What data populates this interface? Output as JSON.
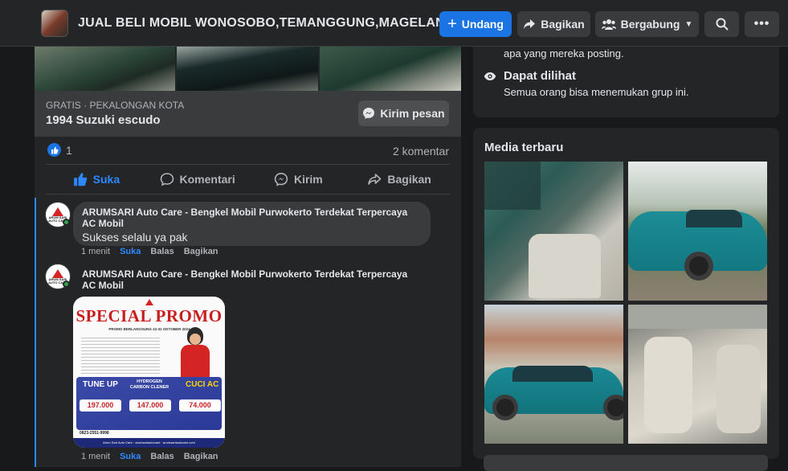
{
  "header": {
    "group_name": "JUAL BELI MOBIL WONOSOBO,TEMANGGUNG,MAGELANG",
    "invite_label": "Undang",
    "share_label": "Bagikan",
    "joined_label": "Bergabung",
    "search_icon": "search-icon",
    "more_icon": "more-icon"
  },
  "listing": {
    "meta": "GRATIS · PEKALONGAN KOTA",
    "title": "1994 Suzuki escudo",
    "message_label": "Kirim pesan"
  },
  "post_stats": {
    "like_count": "1",
    "comment_count": "2 komentar"
  },
  "post_actions": {
    "like": "Suka",
    "comment": "Komentari",
    "send": "Kirim",
    "share": "Bagikan"
  },
  "comments": [
    {
      "author": "ARUMSARI Auto Care - Bengkel Mobil Purwokerto Terdekat Terpercaya AC Mobil",
      "text": "Sukses selalu ya pak",
      "time": "1 menit",
      "like": "Suka",
      "reply": "Balas",
      "share": "Bagikan"
    },
    {
      "author": "ARUMSARI Auto Care - Bengkel Mobil Purwokerto Terdekat Terpercaya AC Mobil",
      "time": "1 menit",
      "like": "Suka",
      "reply": "Balas",
      "share": "Bagikan"
    }
  ],
  "avatar_text": {
    "line1": "ARUM SARI",
    "line2": "AUTO CARE"
  },
  "promo": {
    "title": "SPECIAL PROMO",
    "period": "PROMO BERLANGSUNG 22-31 OKTOBER 2024",
    "services": [
      "TUNE UP",
      "HYDROGEN CARBON CLENER",
      "CUCI AC"
    ],
    "prices": [
      "197.000",
      "147.000",
      "74.000"
    ],
    "phone": "0823-2551-9998",
    "footer": "Arum Sari Auto Care · arumsariautocare · arumsariautocare.com"
  },
  "about": {
    "line1": "apa yang mereka posting.",
    "visible_title": "Dapat dilihat",
    "visible_desc": "Semua orang bisa menemukan grup ini."
  },
  "media": {
    "title": "Media terbaru"
  },
  "colors": {
    "accent": "#1b74e4",
    "link_blue": "#2d88ff",
    "card_bg": "#242526",
    "page_bg": "#18191a",
    "online": "#31a24c"
  }
}
